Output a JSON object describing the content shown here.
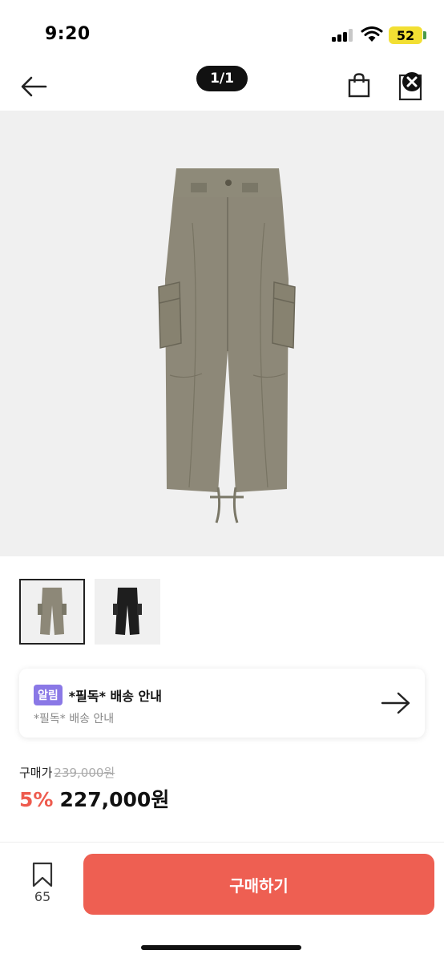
{
  "status_bar": {
    "time": "9:20",
    "battery": "52",
    "icons": [
      "signal-icon",
      "wifi-icon",
      "battery-icon"
    ]
  },
  "header": {
    "page_counter": "1/1",
    "icons": [
      "back-arrow-icon",
      "shopping-bag-icon",
      "close-icon"
    ]
  },
  "product": {
    "image_colors": {
      "khaki": "#8d8878",
      "black": "#1e1e1e"
    }
  },
  "notice": {
    "badge": "알림",
    "title": "*필독* 배송 안내",
    "subtitle": "*필독* 배송 안내"
  },
  "price": {
    "label": "구매가",
    "original": "239,000원",
    "discount": "5%",
    "sale": "227,000원"
  },
  "bottom_bar": {
    "bookmark_count": "65",
    "buy_label": "구매하기"
  },
  "colors": {
    "accent": "#ee5f52",
    "badge": "#8a78e6"
  }
}
